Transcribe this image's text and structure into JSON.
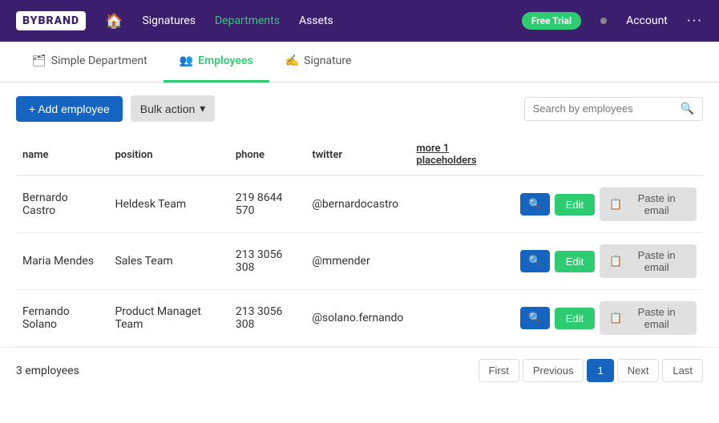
{
  "navbar": {
    "logo": "BYBRAND",
    "links": [
      {
        "label": "Signatures",
        "active": false
      },
      {
        "label": "Departments",
        "active": true
      },
      {
        "label": "Assets",
        "active": false
      }
    ],
    "free_trial": "Free Trial",
    "account": "Account",
    "more": "···"
  },
  "tabs": [
    {
      "id": "simple-department",
      "icon": "🗂",
      "label": "Simple Department",
      "active": false
    },
    {
      "id": "employees",
      "icon": "👥",
      "label": "Employees",
      "active": true
    },
    {
      "id": "signature",
      "icon": "✍",
      "label": "Signature",
      "active": false
    }
  ],
  "toolbar": {
    "add_employee_label": "+ Add employee",
    "bulk_action_label": "Bulk action",
    "search_placeholder": "Search by employees"
  },
  "table": {
    "columns": [
      {
        "key": "name",
        "label": "name",
        "underline": false
      },
      {
        "key": "position",
        "label": "position",
        "underline": false
      },
      {
        "key": "phone",
        "label": "phone",
        "underline": false
      },
      {
        "key": "twitter",
        "label": "twitter",
        "underline": false
      },
      {
        "key": "placeholders",
        "label": "more 1 placeholders",
        "underline": true
      }
    ],
    "rows": [
      {
        "name": "Bernardo Castro",
        "position": "Heldesk Team",
        "phone": "219 8644 570",
        "twitter": "@bernardocastro"
      },
      {
        "name": "Maria Mendes",
        "position": "Sales Team",
        "phone": "213 3056 308",
        "twitter": "@mmender"
      },
      {
        "name": "Fernando Solano",
        "position": "Product Managet Team",
        "phone": "213 3056 308",
        "twitter": "@solano.fernando"
      }
    ],
    "edit_label": "Edit",
    "paste_label": "Paste in email"
  },
  "footer": {
    "count": "3 employees",
    "pagination": {
      "first": "First",
      "previous": "Previous",
      "current": "1",
      "next": "Next",
      "last": "Last"
    }
  }
}
